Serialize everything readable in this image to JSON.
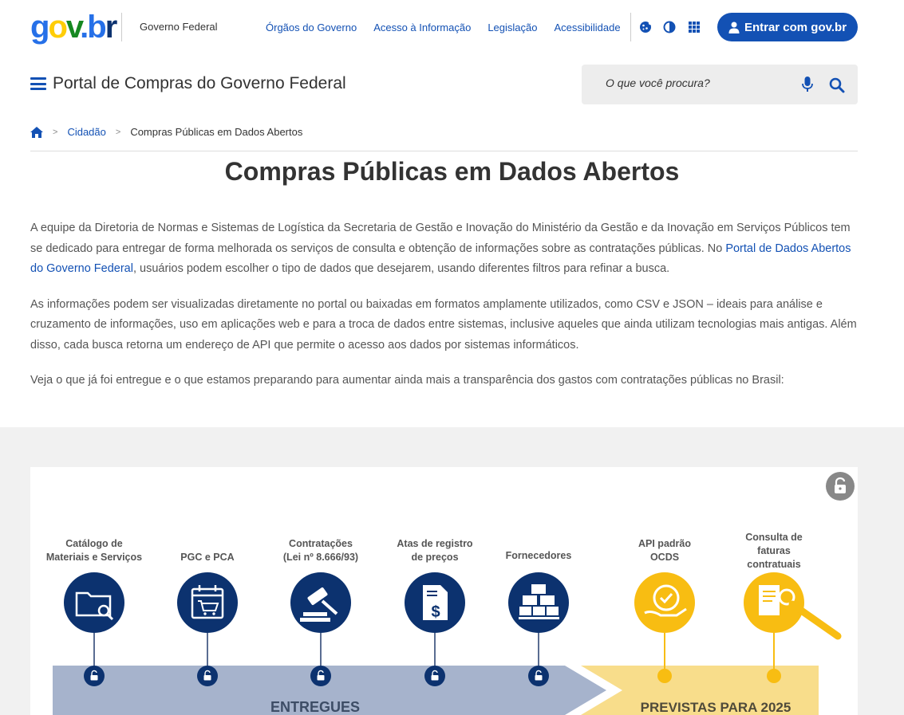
{
  "header": {
    "logo_text": "gov.br",
    "government": "Governo Federal",
    "links": [
      "Órgãos do Governo",
      "Acesso à Informação",
      "Legislação",
      "Acessibilidade"
    ],
    "login_label": "Entrar com gov.br"
  },
  "portal": {
    "title": "Portal de Compras do Governo Federal",
    "search_placeholder": "O que você procura?"
  },
  "breadcrumb": {
    "items": [
      "Cidadão",
      "Compras Públicas em Dados Abertos"
    ]
  },
  "page": {
    "title": "Compras Públicas em Dados Abertos",
    "p1_before": "A equipe da Diretoria de Normas e Sistemas de Logística da Secretaria de Gestão e Inovação do Ministério da Gestão e da Inovação em Serviços Públicos tem se dedicado para entregar de forma melhorada os serviços de consulta e obtenção de informações sobre as contratações públicas. No ",
    "p1_link": "Portal de Dados Abertos do Governo Federal",
    "p1_after": ", usuários podem escolher o tipo de dados que desejarem, usando diferentes filtros para refinar a busca.",
    "p2": "As informações podem ser visualizadas diretamente no portal ou baixadas em formatos amplamente utilizados, como CSV e JSON – ideais para análise e cruzamento de informações, uso em aplicações web e para a troca de dados entre sistemas, inclusive aqueles que ainda utilizam tecnologias mais antigas. Além disso, cada busca retorna um endereço de API que permite o acesso aos dados por sistemas informáticos.",
    "p3": "Veja o que já foi entregue e o que estamos preparando para aumentar ainda mais a transparência dos gastos com contratações públicas no Brasil:"
  },
  "infographic": {
    "delivered_label": "ENTREGUES",
    "planned_label": "PREVISTAS PARA 2025",
    "delivered": [
      {
        "l1": "Catálogo de",
        "l2": "Materiais e Serviços",
        "icon": "folder-search-icon"
      },
      {
        "l1": "",
        "l2": "PGC e PCA",
        "icon": "calendar-cart-icon"
      },
      {
        "l1": "Contratações",
        "l2": "(Lei nº 8.666/93)",
        "icon": "gavel-icon"
      },
      {
        "l1": "Atas de registro",
        "l2": "de preços",
        "icon": "document-dollar-icon"
      },
      {
        "l1": "",
        "l2": "Fornecedores",
        "icon": "boxes-icon"
      }
    ],
    "planned": [
      {
        "l1": "API padrão",
        "l2": "OCDS",
        "icon": "badge-check-icon"
      },
      {
        "l1": "Consulta de faturas",
        "l2": "contratuais",
        "icon": "invoice-search-icon"
      }
    ],
    "colors": {
      "delivered": "#0c326f",
      "planned": "#f8bd12",
      "delivered_band": "#a6b3cc",
      "planned_band": "#f8dd8b"
    }
  }
}
